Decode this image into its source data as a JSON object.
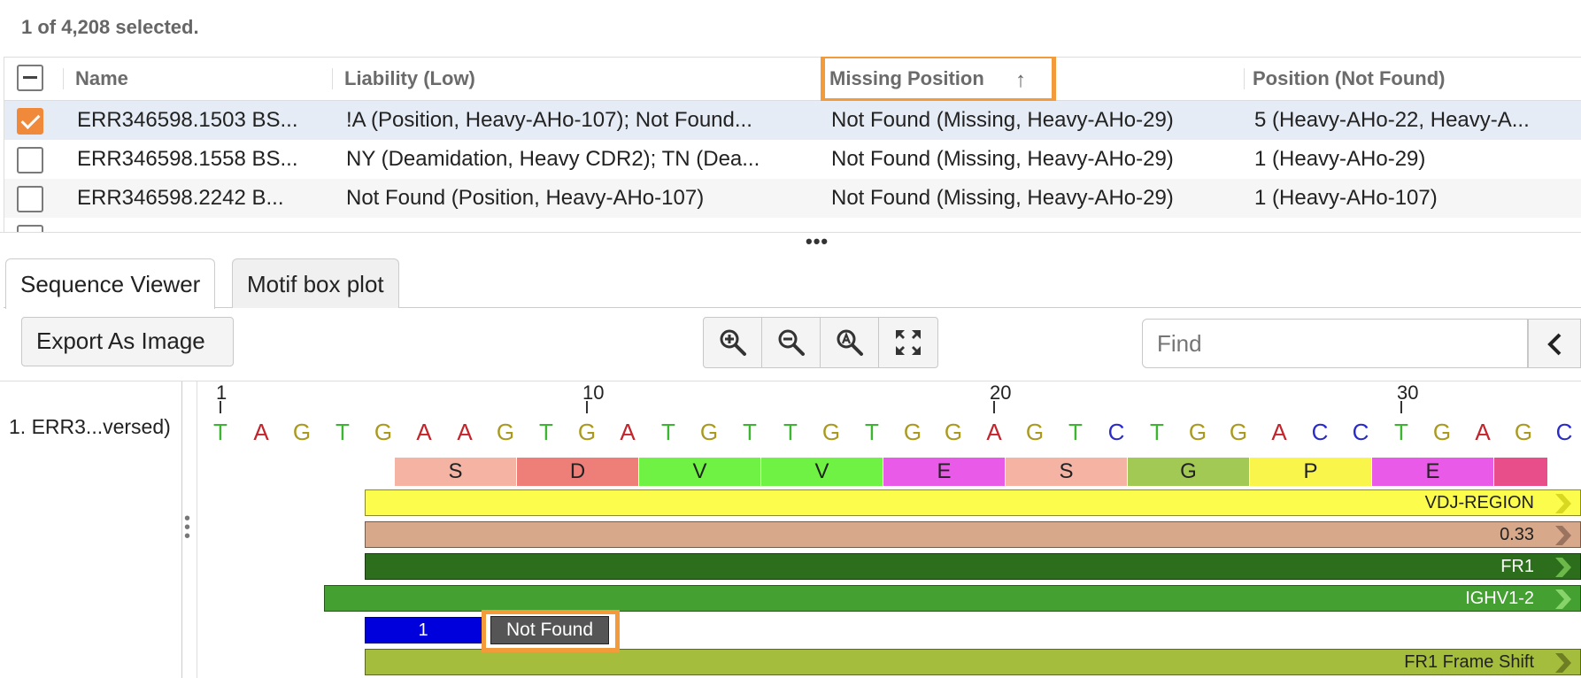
{
  "table": {
    "selection_info": "1 of 4,208 selected.",
    "columns": {
      "name": "Name",
      "liability": "Liability (Low)",
      "missing_position": "Missing Position",
      "position_not_found": "Position (Not Found)"
    },
    "sort_indicator": "ascending",
    "rows": [
      {
        "name": "ERR346598.1503 BS...",
        "liability": "!A (Position, Heavy-AHo-107); Not Found...",
        "missing": "Not Found (Missing, Heavy-AHo-29)",
        "position": "5 (Heavy-AHo-22, Heavy-A...",
        "checked": true
      },
      {
        "name": "ERR346598.1558 BS...",
        "liability": "NY (Deamidation, Heavy CDR2); TN (Dea...",
        "missing": "Not Found (Missing, Heavy-AHo-29)",
        "position": "1 (Heavy-AHo-29)",
        "checked": false
      },
      {
        "name": "ERR346598.2242 B...",
        "liability": "Not Found (Position, Heavy-AHo-107)",
        "missing": "Not Found (Missing, Heavy-AHo-29)",
        "position": "1 (Heavy-AHo-107)",
        "checked": false
      }
    ]
  },
  "tabs": [
    "Sequence Viewer",
    "Motif box plot"
  ],
  "toolbar": {
    "export_label": "Export As Image",
    "find_placeholder": "Find",
    "zoom_icons": [
      "zoom-in-icon",
      "zoom-out-icon",
      "zoom-to-fit-icon",
      "expand-icon"
    ]
  },
  "viewer": {
    "sequence_name": "1. ERR3...versed)",
    "ruler_labels": [
      "1",
      "10",
      "20",
      "30"
    ],
    "nucleotides": [
      "T",
      "A",
      "G",
      "T",
      "G",
      "A",
      "A",
      "G",
      "T",
      "G",
      "A",
      "T",
      "G",
      "T",
      "T",
      "G",
      "T",
      "G",
      "G",
      "A",
      "G",
      "T",
      "C",
      "T",
      "G",
      "G",
      "A",
      "C",
      "C",
      "T",
      "G",
      "A",
      "G",
      "C"
    ],
    "nucleotide_colors": {
      "T": "#3cb531",
      "A": "#c0262b",
      "G": "#a99a1f",
      "C": "#2b2bc7"
    },
    "amino_acids": [
      {
        "label": "S",
        "color": "#f4b3a3"
      },
      {
        "label": "D",
        "color": "#ee7f78"
      },
      {
        "label": "V",
        "color": "#6ff244"
      },
      {
        "label": "V",
        "color": "#6ff244"
      },
      {
        "label": "E",
        "color": "#ea5ae8"
      },
      {
        "label": "S",
        "color": "#f4b3a3"
      },
      {
        "label": "G",
        "color": "#a3c955"
      },
      {
        "label": "P",
        "color": "#f9f54a"
      },
      {
        "label": "E",
        "color": "#ea5ae8"
      }
    ],
    "annotations": [
      {
        "label": "VDJ-REGION",
        "color": "#fcfc4c",
        "text_color": "#222",
        "arrow": "#d8d820"
      },
      {
        "label": "0.33",
        "color": "#d7a88a",
        "text_color": "#222",
        "arrow": "#9b7460"
      },
      {
        "label": "FR1",
        "color": "#2c6e1c",
        "text_color": "#ffffff",
        "arrow": "#6cb84a"
      },
      {
        "label": "IGHV1-2",
        "color": "#45a032",
        "text_color": "#ffffff",
        "arrow": "#86d46a"
      },
      {
        "label": "FR1 Frame Shift",
        "color": "#a5bd3c",
        "text_color": "#222",
        "arrow": "#6e7e22"
      }
    ],
    "marker_blue_label": "1",
    "marker_not_found_label": "Not Found"
  }
}
